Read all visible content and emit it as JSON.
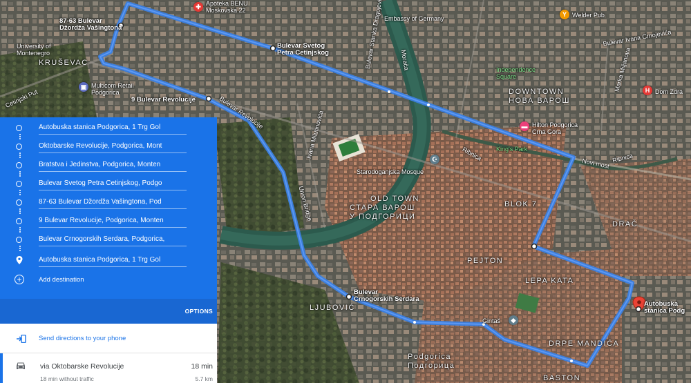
{
  "map": {
    "streets": [
      "87-63 Bulevar Džorđa Vašingtona",
      "University of Montenegro",
      "KRUŠEVAC",
      "Multicom Retail Podgorica",
      "9 Bulevar Revolucije",
      "Bulevar Revolucije",
      "Bulevar Svetog Petra Cetinjskog",
      "Apoteka BENU Moskovska 22",
      "Embassy of Germany",
      "Welder Pub",
      "Bulevar Ivana Crnojevića",
      "Independence Square",
      "DOWNTOWN",
      "НОВА ВАРОШ",
      "Dom Zdra",
      "Hilton Podgorica Crna Gora",
      "King's Park",
      "Ribnica",
      "Novi most",
      "Starodoganjska Mosque",
      "OLD TOWN",
      "СТАРА ВАРОШ",
      "У ПОДГОРИЦИ",
      "BLOK 7",
      "DRAČ",
      "PEJTON",
      "LEPA KATA",
      "Gintaš",
      "DRPE MANDIĆA",
      "BASTON",
      "Bulevar Crnogorskih Serdara",
      "LJUBOVIĆ",
      "Podgorica",
      "Подгорица",
      "Autobuska stanica Podgorica",
      "Morača",
      "Ivana Milutinovića",
      "Union Bridge",
      "Cetinjski Put",
      "Marka Miljanova",
      "Bulevar Stanka Dragojevića"
    ],
    "route_color": "#4a8af4",
    "destination_pin_color": "#ea4335"
  },
  "panel": {
    "waypoints": [
      {
        "text": "Autobuska stanica Podgorica, 1 Trg Gol",
        "icon": "circle-icon"
      },
      {
        "text": "Oktobarske Revolucije, Podgorica, Mont",
        "icon": "circle-icon"
      },
      {
        "text": "Bratstva i Jedinstva, Podgorica, Monten",
        "icon": "circle-icon"
      },
      {
        "text": "Bulevar Svetog Petra Cetinjskog, Podgo",
        "icon": "circle-icon"
      },
      {
        "text": "87-63 Bulevar Džordža Vašingtona, Pod",
        "icon": "circle-icon"
      },
      {
        "text": "9 Bulevar Revolucije, Podgorica, Monten",
        "icon": "circle-icon"
      },
      {
        "text": "Bulevar Crnogorskih Serdara, Podgorica,",
        "icon": "circle-icon"
      },
      {
        "text": "Autobuska stanica Podgorica, 1 Trg Gol",
        "icon": "pin-icon"
      }
    ],
    "add_destination": "Add destination",
    "options": "OPTIONS",
    "send_directions": "Send directions to your phone",
    "route": {
      "via": "via Oktobarske Revolucije",
      "time": "18 min",
      "traffic": "18 min without traffic",
      "distance": "5.7 km"
    },
    "accent_color": "#1a73e8"
  }
}
